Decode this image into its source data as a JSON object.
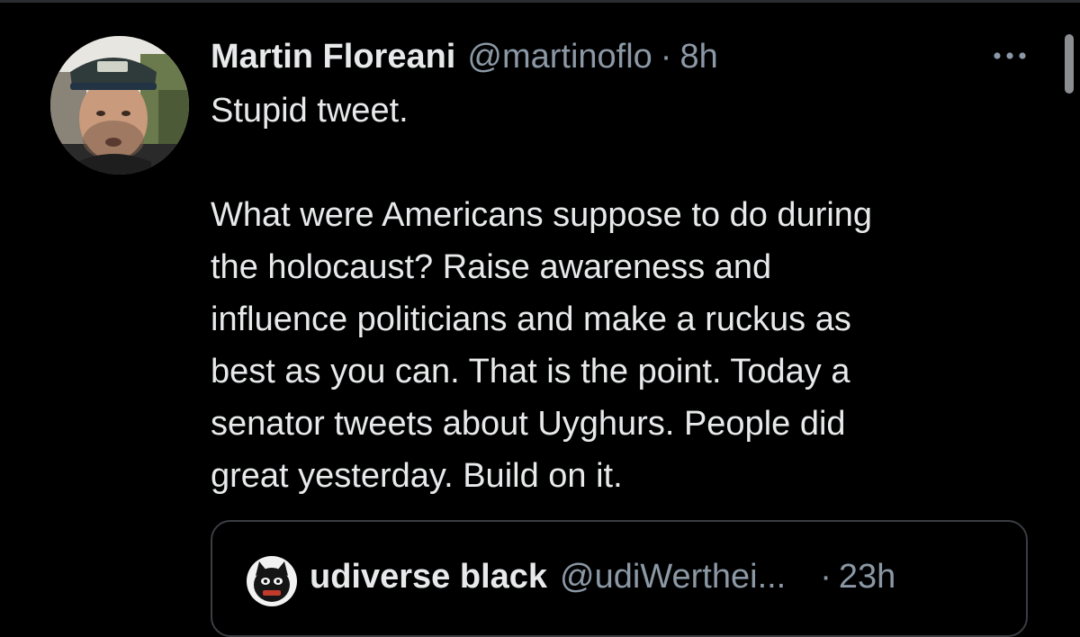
{
  "tweet": {
    "display_name": "Martin Floreani",
    "handle": "@martinoflo",
    "separator": "·",
    "time": "8h",
    "body": "Stupid tweet.\n\nWhat were Americans suppose to do during\nthe holocaust? Raise awareness and\ninfluence politicians and make a ruckus as\nbest as you can. That is the point. Today a\nsenator tweets about Uyghurs. People did\ngreat yesterday. Build on it."
  },
  "quoted_tweet": {
    "display_name": "udiverse black",
    "handle": "@udiWerthei...",
    "separator": "·",
    "time": "23h"
  },
  "icons": {
    "more": "more-horizontal-icon",
    "avatar": "profile-photo",
    "quote_avatar": "profile-photo"
  },
  "colors": {
    "background": "#000000",
    "primary_text": "#e7e9ea",
    "secondary_text": "#8b98a5",
    "border": "#3a3d42"
  }
}
